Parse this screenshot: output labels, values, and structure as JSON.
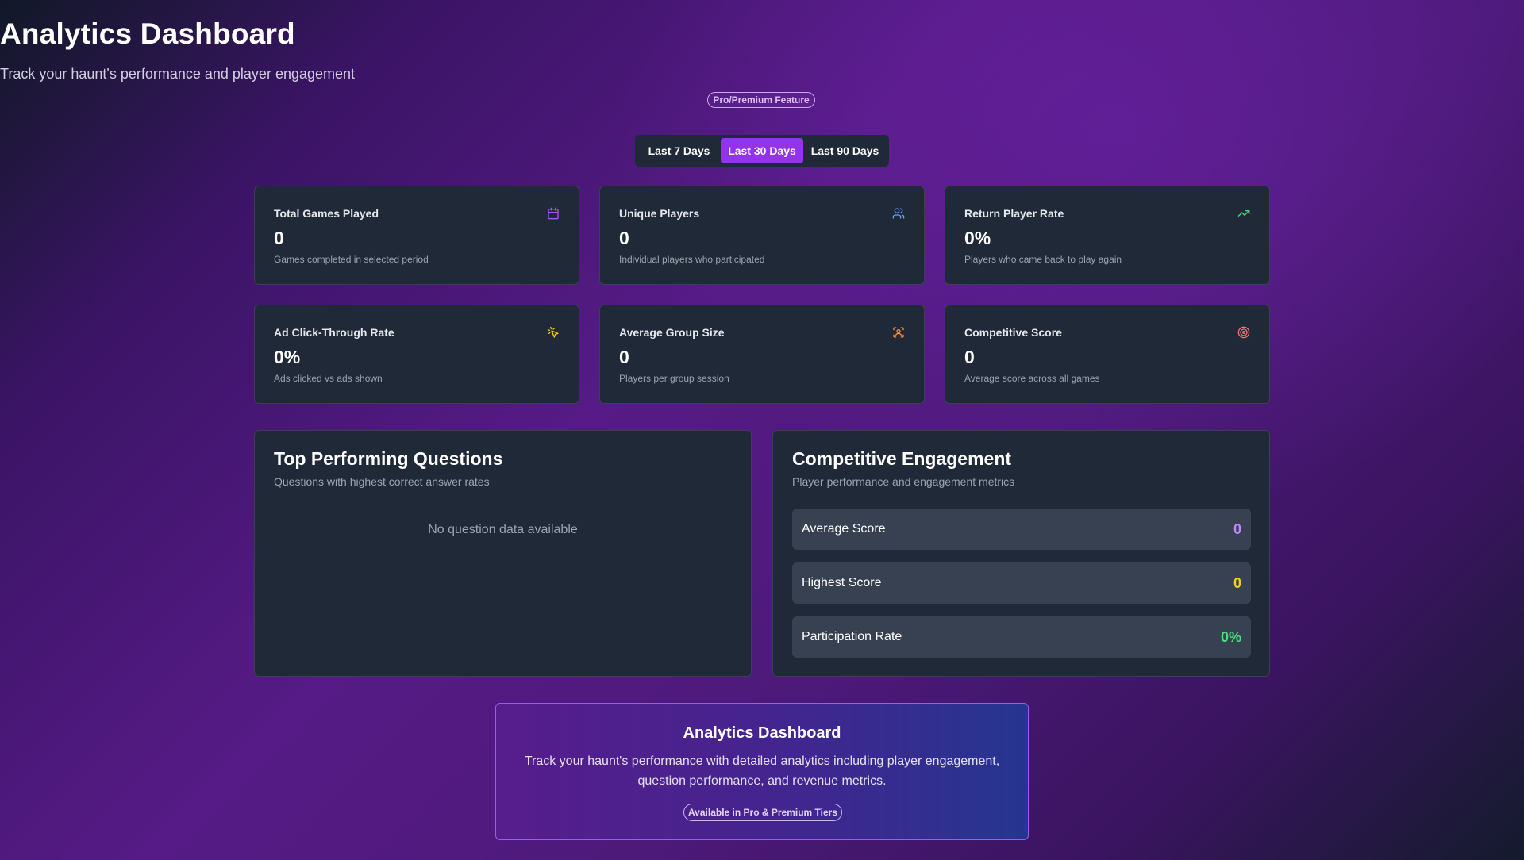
{
  "header": {
    "title": "Analytics Dashboard",
    "subtitle": "Track your haunt's performance and player engagement",
    "badge": "Pro/Premium Feature"
  },
  "date_range": {
    "options": [
      "Last 7 Days",
      "Last 30 Days",
      "Last 90 Days"
    ],
    "selected": "Last 30 Days"
  },
  "stats": [
    {
      "label": "Total Games Played",
      "value": "0",
      "description": "Games completed in selected period",
      "icon": "calendar-icon",
      "icon_color": "#a855f7"
    },
    {
      "label": "Unique Players",
      "value": "0",
      "description": "Individual players who participated",
      "icon": "users-icon",
      "icon_color": "#60a5fa"
    },
    {
      "label": "Return Player Rate",
      "value": "0%",
      "description": "Players who came back to play again",
      "icon": "trending-up-icon",
      "icon_color": "#4ade80"
    },
    {
      "label": "Ad Click-Through Rate",
      "value": "0%",
      "description": "Ads clicked vs ads shown",
      "icon": "mouse-pointer-click-icon",
      "icon_color": "#facc15"
    },
    {
      "label": "Average Group Size",
      "value": "0",
      "description": "Players per group session",
      "icon": "group-scan-icon",
      "icon_color": "#fb923c"
    },
    {
      "label": "Competitive Score",
      "value": "0",
      "description": "Average score across all games",
      "icon": "target-icon",
      "icon_color": "#f87171"
    }
  ],
  "top_questions": {
    "title": "Top Performing Questions",
    "subtitle": "Questions with highest correct answer rates",
    "empty_message": "No question data available"
  },
  "engagement": {
    "title": "Competitive Engagement",
    "subtitle": "Player performance and engagement metrics",
    "metrics": [
      {
        "label": "Average Score",
        "value": "0",
        "color": "#c084fc"
      },
      {
        "label": "Highest Score",
        "value": "0",
        "color": "#facc15"
      },
      {
        "label": "Participation Rate",
        "value": "0%",
        "color": "#4ade80"
      }
    ]
  },
  "promo": {
    "title": "Analytics Dashboard",
    "text": "Track your haunt's performance with detailed analytics including player engagement, question performance, and revenue metrics.",
    "badge": "Available in Pro & Premium Tiers"
  },
  "colors": {
    "accent": "#9333ea",
    "card_bg": "#1f2937",
    "row_bg": "#374151"
  }
}
